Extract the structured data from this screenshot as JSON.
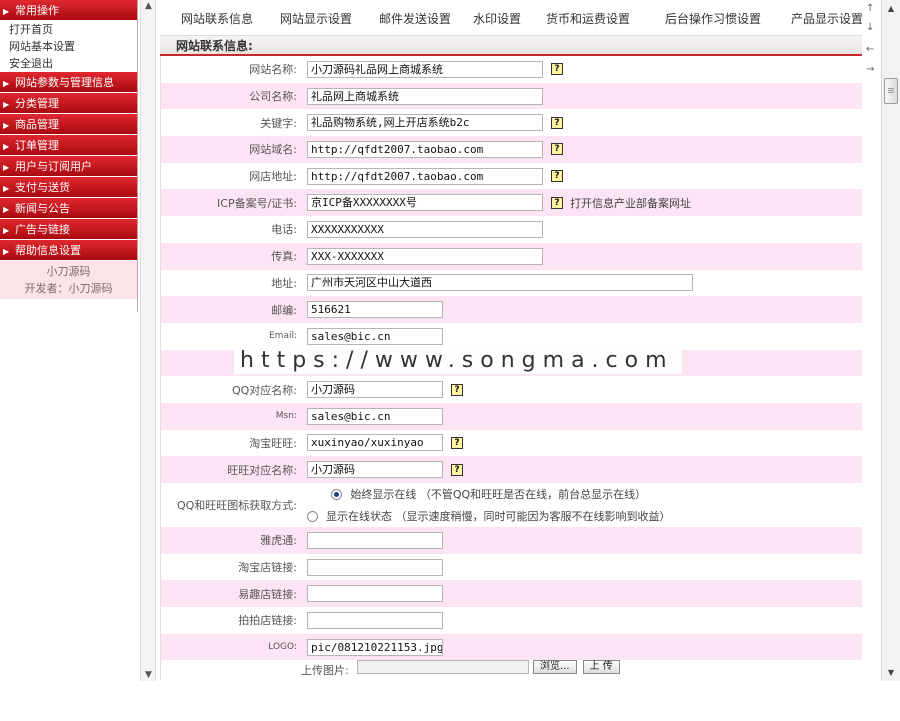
{
  "sidebar": {
    "sections": [
      {
        "label": "常用操作",
        "items": [
          "打开首页",
          "网站基本设置",
          "安全退出"
        ]
      },
      {
        "label": "网站参数与管理信息",
        "items": []
      },
      {
        "label": "分类管理",
        "items": []
      },
      {
        "label": "商品管理",
        "items": []
      },
      {
        "label": "订单管理",
        "items": []
      },
      {
        "label": "用户与订阅用户",
        "items": []
      },
      {
        "label": "支付与送货",
        "items": []
      },
      {
        "label": "新闻与公告",
        "items": []
      },
      {
        "label": "广告与链接",
        "items": []
      },
      {
        "label": "帮助信息设置",
        "items": []
      }
    ],
    "footer_line1": "小刀源码",
    "footer_line2": "开发者：小刀源码"
  },
  "tabs": [
    "网站联系信息",
    "网站显示设置",
    "邮件发送设置",
    "水印设置",
    "货币和运费设置",
    "后台操作习惯设置",
    "产品显示设置"
  ],
  "section_title": "网站联系信息:",
  "form": {
    "site_name_label": "网站名称:",
    "site_name": "小刀源码礼品网上商城系统",
    "company_label": "公司名称:",
    "company": "礼品网上商城系统",
    "keywords_label": "关键字:",
    "keywords": "礼品购物系统,网上开店系统b2c",
    "domain_label": "网站域名:",
    "domain": "http://qfdt2007.taobao.com",
    "shop_label": "网店地址:",
    "shop": "http://qfdt2007.taobao.com",
    "icp_label": "ICP备案号/证书:",
    "icp": "京ICP备XXXXXXXX号",
    "icp_note": "打开信息产业部备案网址",
    "phone_label": "电话:",
    "phone": "XXXXXXXXXXX",
    "fax_label": "传真:",
    "fax": "XXX-XXXXXXX",
    "address_label": "地址:",
    "address": "广州市天河区中山大道西",
    "zip_label": "邮编:",
    "zip": "516621",
    "email_label": "Email:",
    "email": "sales@bic.cn",
    "qq_label": "QQ对应名称:",
    "qq": "小刀源码",
    "msn_label": "Msn:",
    "msn": "sales@bic.cn",
    "taobao_label": "淘宝旺旺:",
    "taobao": "xuxinyao/xuxinyao",
    "wangwang_label": "旺旺对应名称:",
    "wangwang": "小刀源码",
    "icon_mode_label": "QQ和旺旺图标获取方式:",
    "icon_mode_opt1": "始终显示在线 （不管QQ和旺旺是否在线，前台总显示在线）",
    "icon_mode_opt2": "显示在线状态 （显示速度稍慢，同时可能因为客服不在线影响到收益）",
    "yahoo_label": "雅虎通:",
    "taobao_link_label": "淘宝店链接:",
    "eqiao_link_label": "易趣店链接:",
    "paipai_link_label": "拍拍店链接:",
    "logo_label": "LOGO:",
    "logo": "pic/081210221153.jpg",
    "upload_label": "上传图片:",
    "browse_label": "浏览...",
    "upload_button": "上 传",
    "help_glyph": "?"
  },
  "watermark": "https://www.songma.com"
}
